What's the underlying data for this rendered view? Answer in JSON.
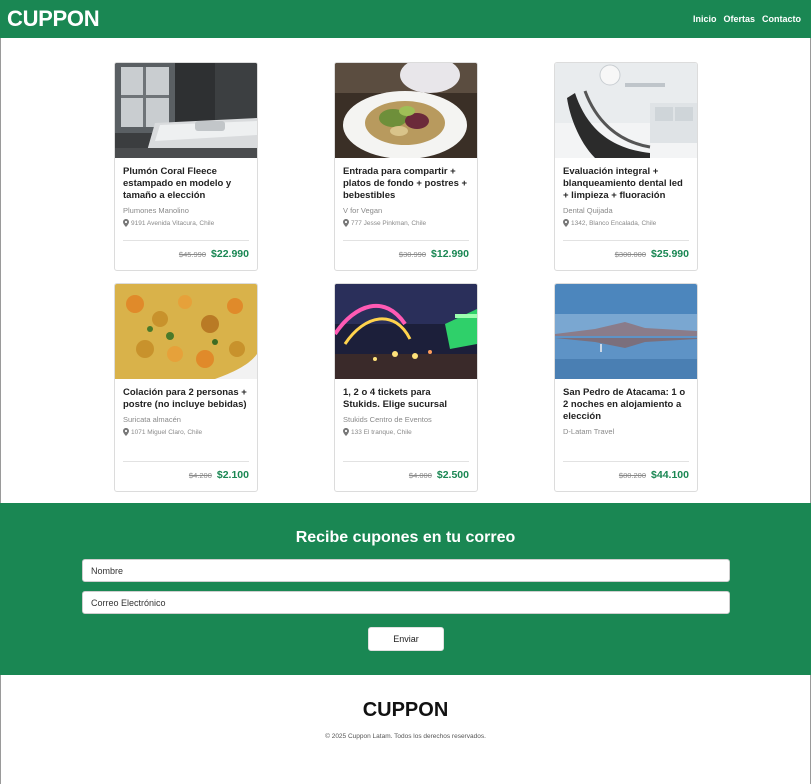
{
  "header": {
    "logo": "CUPPON",
    "nav": [
      {
        "label": "Inicio"
      },
      {
        "label": "Ofertas"
      },
      {
        "label": "Contacto"
      }
    ]
  },
  "colors": {
    "brand": "#1a8753",
    "price": "#1a8753",
    "muted": "#8a8a8a"
  },
  "deals": [
    {
      "image": "bedroom-bed-photo",
      "title": "Plumón Coral Fleece estampado en modelo y tamaño a elección",
      "merchant": "Plumones Manolino",
      "address": "9191 Avenida Vitacura, Chile",
      "old_price": "$45.990",
      "new_price": "$22.990"
    },
    {
      "image": "salad-plate-photo",
      "title": "Entrada para compartir + platos de fondo + postres + bebestibles",
      "merchant": "V for Vegan",
      "address": "777 Jesse Pinkman, Chile",
      "old_price": "$30.990",
      "new_price": "$12.990"
    },
    {
      "image": "dental-chair-photo",
      "title": "Evaluación integral + blanqueamiento dental led + limpieza + fluoración",
      "merchant": "Dental Quijada",
      "address": "1342, Blanco Encalada, Chile",
      "old_price": "$300.000",
      "new_price": "$25.990"
    },
    {
      "image": "rice-dish-photo",
      "title": "Colación para 2 personas + postre (no incluye bebidas)",
      "merchant": "Suricata almacén",
      "address": "1071 Miguel Claro, Chile",
      "old_price": "$4.200",
      "new_price": "$2.100"
    },
    {
      "image": "amusement-park-photo",
      "title": "1, 2 o 4 tickets para Stukids. Elige sucursal",
      "merchant": "Stukids Centro de Eventos",
      "address": "133 El tranque, Chile",
      "old_price": "$4.000",
      "new_price": "$2.500"
    },
    {
      "image": "atacama-lagoon-photo",
      "title": "San Pedro de Atacama: 1 o 2 noches en alojamiento a elección",
      "merchant": "D-Latam Travel",
      "address": "",
      "old_price": "$80.200",
      "new_price": "$44.100"
    }
  ],
  "newsletter": {
    "title": "Recibe cupones en tu correo",
    "name_placeholder": "Nombre",
    "email_placeholder": "Correo Electrónico",
    "button_label": "Enviar"
  },
  "footer": {
    "logo": "CUPPON",
    "copyright": "© 2025 Cuppon Latam. Todos los derechos reservados."
  }
}
